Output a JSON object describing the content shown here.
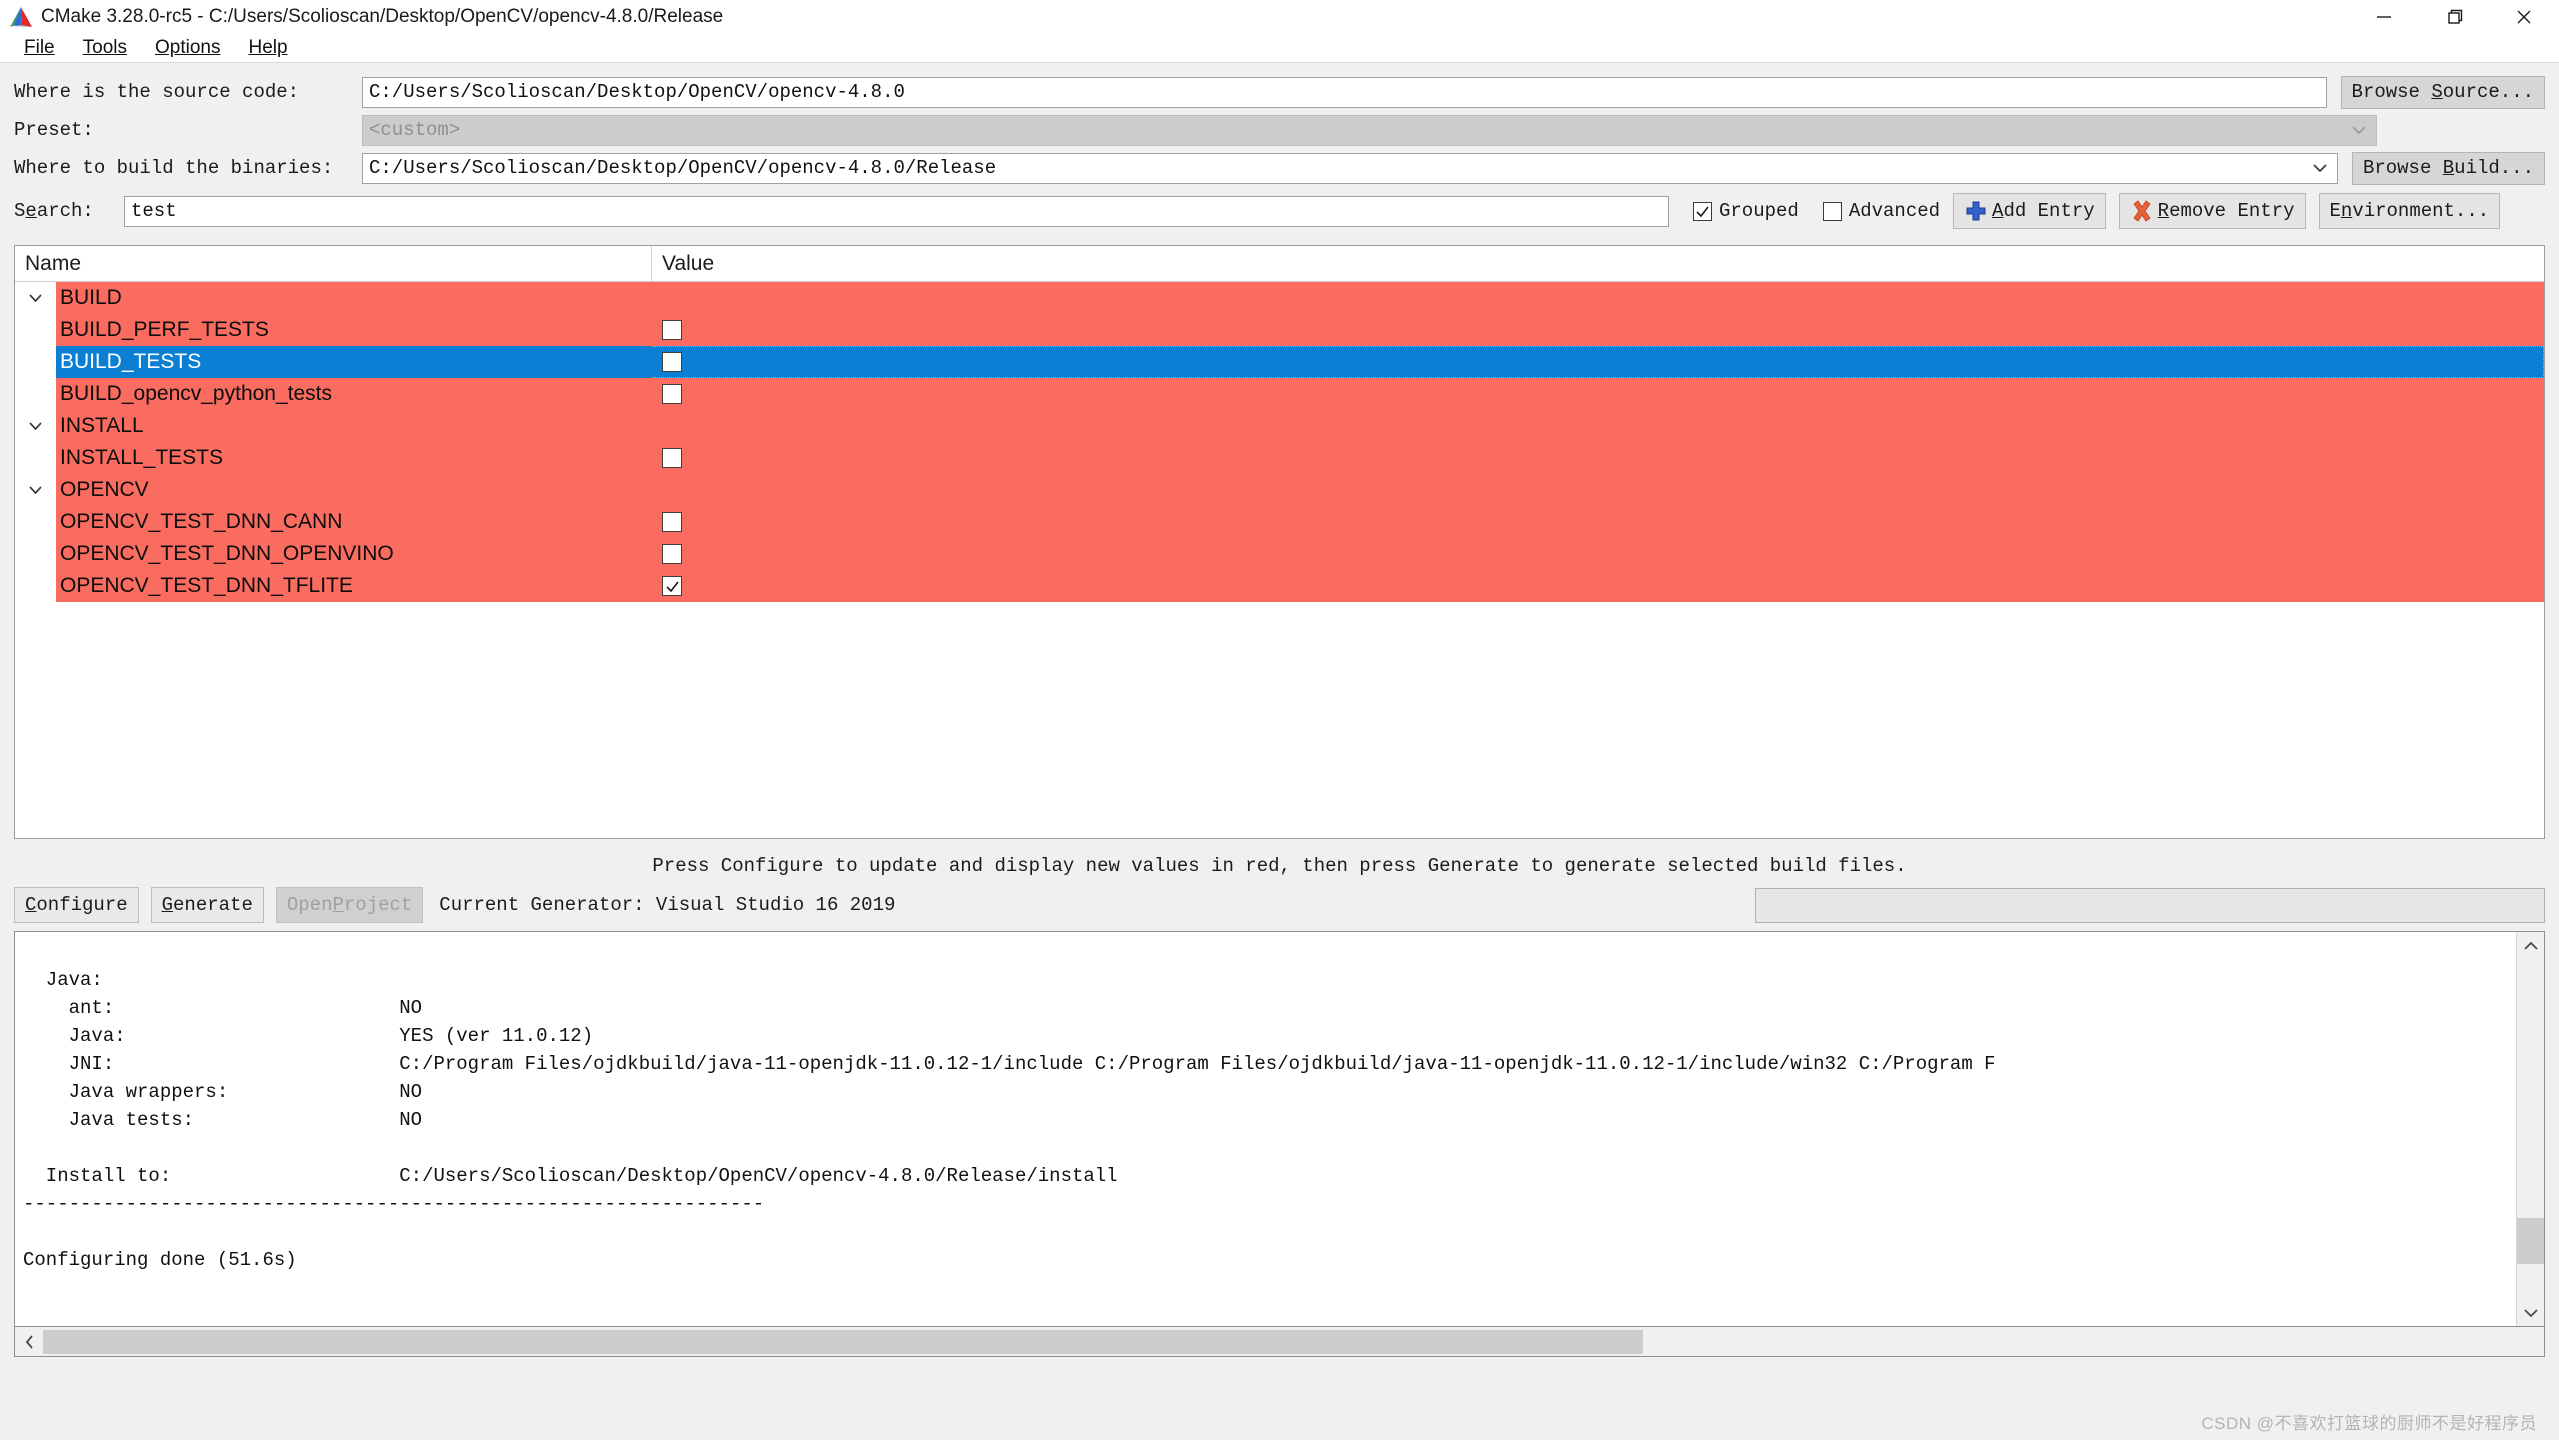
{
  "window": {
    "title": "CMake 3.28.0-rc5 - C:/Users/Scolioscan/Desktop/OpenCV/opencv-4.8.0/Release",
    "app_icon": "cmake-triangle-icon",
    "controls": {
      "minimize": "minimize-icon",
      "maximize": "restore-icon",
      "close": "close-icon"
    }
  },
  "menubar": {
    "items": [
      {
        "label": "File",
        "mnemonic": "F"
      },
      {
        "label": "Tools",
        "mnemonic": "T"
      },
      {
        "label": "Options",
        "mnemonic": "O"
      },
      {
        "label": "Help",
        "mnemonic": "H"
      }
    ]
  },
  "form": {
    "source": {
      "label": "Where is the source code:",
      "value": "C:/Users/Scolioscan/Desktop/OpenCV/opencv-4.8.0",
      "browse_label": "Browse Source..."
    },
    "preset": {
      "label": "Preset:",
      "value": "<custom>",
      "disabled": true
    },
    "build": {
      "label": "Where to build the binaries:",
      "value": "C:/Users/Scolioscan/Desktop/OpenCV/opencv-4.8.0/Release",
      "browse_label": "Browse Build..."
    },
    "search": {
      "label": "Search:",
      "value": "test",
      "placeholder": ""
    },
    "grouped": {
      "label": "Grouped",
      "checked": true
    },
    "advanced": {
      "label": "Advanced",
      "checked": false
    },
    "add_entry": {
      "label": "Add Entry",
      "icon": "plus-icon"
    },
    "remove_entry": {
      "label": "Remove Entry",
      "icon": "x-mark-icon"
    },
    "environment": {
      "label": "Environment..."
    }
  },
  "cache": {
    "columns": {
      "name": "Name",
      "value": "Value"
    },
    "rows": [
      {
        "kind": "group",
        "name": "BUILD",
        "expanded": true
      },
      {
        "kind": "entry",
        "name": "BUILD_PERF_TESTS",
        "checked": false,
        "selected": false
      },
      {
        "kind": "entry",
        "name": "BUILD_TESTS",
        "checked": false,
        "selected": true
      },
      {
        "kind": "entry",
        "name": "BUILD_opencv_python_tests",
        "checked": false,
        "selected": false
      },
      {
        "kind": "group",
        "name": "INSTALL",
        "expanded": true
      },
      {
        "kind": "entry",
        "name": "INSTALL_TESTS",
        "checked": false,
        "selected": false
      },
      {
        "kind": "group",
        "name": "OPENCV",
        "expanded": true
      },
      {
        "kind": "entry",
        "name": "OPENCV_TEST_DNN_CANN",
        "checked": false,
        "selected": false
      },
      {
        "kind": "entry",
        "name": "OPENCV_TEST_DNN_OPENVINO",
        "checked": false,
        "selected": false
      },
      {
        "kind": "entry",
        "name": "OPENCV_TEST_DNN_TFLITE",
        "checked": true,
        "selected": false
      }
    ],
    "new_value_color": "#fa6b60",
    "selection_color": "#0b7fd4"
  },
  "status": {
    "hint": "Press Configure to update and display new values in red, then press Generate to generate selected build files."
  },
  "actions": {
    "configure": {
      "label": "Configure",
      "mnemonic": "C",
      "disabled": false
    },
    "generate": {
      "label": "Generate",
      "mnemonic": "G",
      "disabled": false
    },
    "open_project": {
      "label": "Open Project",
      "mnemonic": "P",
      "disabled": true
    },
    "generator_text": "Current Generator: Visual Studio 16 2019",
    "progress": 0
  },
  "log": {
    "lines": [
      "",
      "  Java:",
      "    ant:                         NO",
      "    Java:                        YES (ver 11.0.12)",
      "    JNI:                         C:/Program Files/ojdkbuild/java-11-openjdk-11.0.12-1/include C:/Program Files/ojdkbuild/java-11-openjdk-11.0.12-1/include/win32 C:/Program F",
      "    Java wrappers:               NO",
      "    Java tests:                  NO",
      "",
      "  Install to:                    C:/Users/Scolioscan/Desktop/OpenCV/opencv-4.8.0/Release/install",
      "-----------------------------------------------------------------",
      "",
      "Configuring done (51.6s)"
    ]
  },
  "watermark": {
    "text": "CSDN @不喜欢打篮球的厨师不是好程序员"
  }
}
